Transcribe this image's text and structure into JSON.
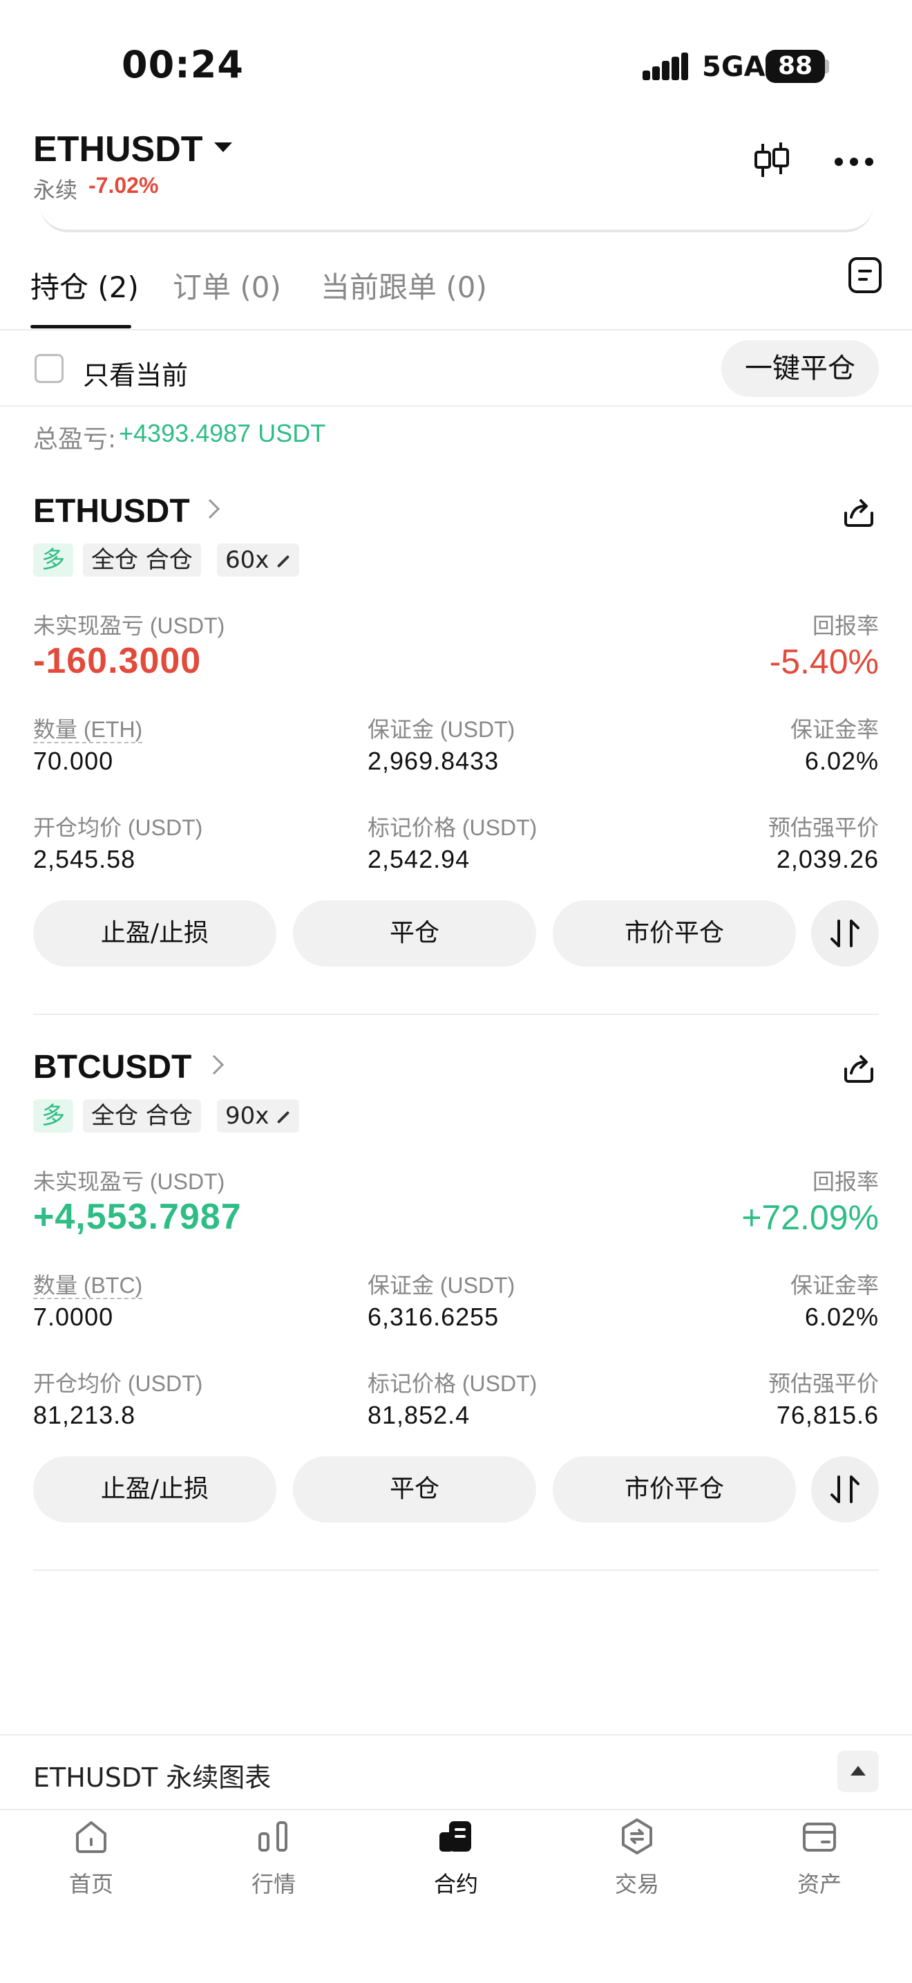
{
  "status_bar": {
    "time": "00:24",
    "network": "5GA",
    "battery": "88"
  },
  "header": {
    "symbol": "ETHUSDT",
    "perp_label": "永续",
    "change": "-7.02%"
  },
  "tabs": [
    {
      "label": "持仓 (2)"
    },
    {
      "label": "订单 (0)"
    },
    {
      "label": "当前跟单 (0)"
    }
  ],
  "filter": {
    "only_current_label": "只看当前",
    "close_all_label": "一键平仓"
  },
  "summary": {
    "total_pnl_label": "总盈亏:",
    "total_pnl_value": "+4393.4987 USDT"
  },
  "positions": [
    {
      "symbol": "ETHUSDT",
      "side": "多",
      "margin_mode": "全仓 合仓",
      "leverage": "60x",
      "unrealized_label": "未实现盈亏 (USDT)",
      "unrealized_value": "-160.3000",
      "roe_label": "回报率",
      "roe_value": "-5.40%",
      "qty_label": "数量 (ETH)",
      "qty_value": "70.000",
      "margin_label": "保证金 (USDT)",
      "margin_value": "2,969.8433",
      "margin_rate_label": "保证金率",
      "margin_rate_value": "6.02%",
      "entry_label": "开仓均价 (USDT)",
      "entry_value": "2,545.58",
      "mark_label": "标记价格 (USDT)",
      "mark_value": "2,542.94",
      "liq_label": "预估强平价",
      "liq_value": "2,039.26",
      "btn_tpsl": "止盈/止损",
      "btn_close": "平仓",
      "btn_market_close": "市价平仓"
    },
    {
      "symbol": "BTCUSDT",
      "side": "多",
      "margin_mode": "全仓 合仓",
      "leverage": "90x",
      "unrealized_label": "未实现盈亏 (USDT)",
      "unrealized_value": "+4,553.7987",
      "roe_label": "回报率",
      "roe_value": "+72.09%",
      "qty_label": "数量 (BTC)",
      "qty_value": "7.0000",
      "margin_label": "保证金 (USDT)",
      "margin_value": "6,316.6255",
      "margin_rate_label": "保证金率",
      "margin_rate_value": "6.02%",
      "entry_label": "开仓均价 (USDT)",
      "entry_value": "81,213.8",
      "mark_label": "标记价格 (USDT)",
      "mark_value": "81,852.4",
      "liq_label": "预估强平价",
      "liq_value": "76,815.6",
      "btn_tpsl": "止盈/止损",
      "btn_close": "平仓",
      "btn_market_close": "市价平仓"
    }
  ],
  "chart_bar": {
    "label": "ETHUSDT 永续图表"
  },
  "bottom_nav": [
    {
      "label": "首页",
      "icon": "home-icon"
    },
    {
      "label": "行情",
      "icon": "market-icon"
    },
    {
      "label": "合约",
      "icon": "futures-icon"
    },
    {
      "label": "交易",
      "icon": "trade-icon"
    },
    {
      "label": "资产",
      "icon": "wallet-icon"
    }
  ],
  "colors": {
    "up": "#2ebd85",
    "down": "#e24a3b",
    "muted": "#888888"
  }
}
